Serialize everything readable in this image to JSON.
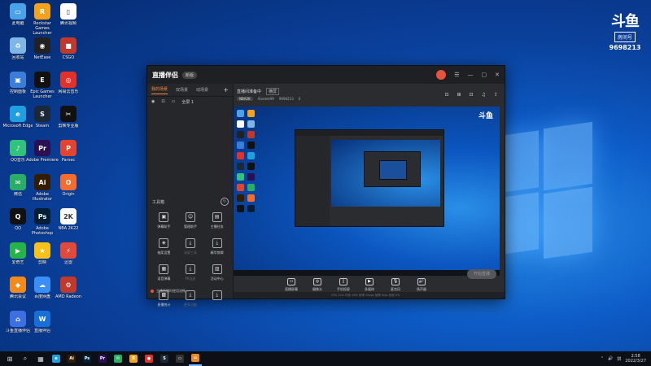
{
  "desktop": {
    "icons": [
      {
        "label": "此电脑",
        "color": "#4aa3e8",
        "glyph": "▭"
      },
      {
        "label": "Rockstar Games Launcher",
        "color": "#f3a21b",
        "glyph": "R"
      },
      {
        "label": "腾讯视频",
        "color": "#ffffff",
        "glyph": "▯"
      },
      {
        "label": "回收站",
        "color": "#7fb6e6",
        "glyph": "♻"
      },
      {
        "label": "NetEase",
        "color": "#222222",
        "glyph": "◉"
      },
      {
        "label": "CSGO",
        "color": "#c0392b",
        "glyph": "■"
      },
      {
        "label": "控制面板",
        "color": "#3b7dd8",
        "glyph": "▣"
      },
      {
        "label": "Epic Games Launcher",
        "color": "#111111",
        "glyph": "E"
      },
      {
        "label": "网易云音乐",
        "color": "#e0322b",
        "glyph": "◎"
      },
      {
        "label": "Microsoft Edge",
        "color": "#1f9ee0",
        "glyph": "e"
      },
      {
        "label": "Steam",
        "color": "#1b2838",
        "glyph": "S"
      },
      {
        "label": "剪映专业版",
        "color": "#111111",
        "glyph": "✂"
      },
      {
        "label": "QQ音乐",
        "color": "#31c27c",
        "glyph": "♪"
      },
      {
        "label": "Adobe Premiere",
        "color": "#2a0f55",
        "glyph": "Pr"
      },
      {
        "label": "Parsec",
        "color": "#e2452f",
        "glyph": "P"
      },
      {
        "label": "微信",
        "color": "#2aae67",
        "glyph": "✉"
      },
      {
        "label": "Adobe Illustrator",
        "color": "#331c00",
        "glyph": "Ai"
      },
      {
        "label": "Origin",
        "color": "#f56c2d",
        "glyph": "O"
      },
      {
        "label": "QQ",
        "color": "#111111",
        "glyph": "Q"
      },
      {
        "label": "Adobe Photoshop",
        "color": "#001e36",
        "glyph": "Ps"
      },
      {
        "label": "NBA 2K22",
        "color": "#ffffff",
        "glyph": "2K"
      },
      {
        "label": "爱奇艺",
        "color": "#25b34a",
        "glyph": "▶"
      },
      {
        "label": "剪映",
        "color": "#f6c21a",
        "glyph": "★"
      },
      {
        "label": "迅雷",
        "color": "#e04a3a",
        "glyph": "⚡"
      },
      {
        "label": "腾讯会议",
        "color": "#f08a1a",
        "glyph": "◆"
      },
      {
        "label": "百度网盘",
        "color": "#3a8ef6",
        "glyph": "☁"
      },
      {
        "label": "AMD Radeon",
        "color": "#c0392b",
        "glyph": "⚙"
      },
      {
        "label": "斗鱼直播伴侣",
        "color": "#3d6fe0",
        "glyph": "⌂"
      },
      {
        "label": "直播伴侣",
        "color": "#1a6fd6",
        "glyph": "W"
      }
    ]
  },
  "badge": {
    "logo": "斗鱼",
    "tag": "房间号",
    "room": "9698213"
  },
  "app": {
    "brand": "直播伴侣",
    "version": "新版",
    "titlebar_icons": [
      "☰",
      "—",
      "▢",
      "✕"
    ],
    "tabs": [
      {
        "label": "我的场景",
        "active": true
      },
      {
        "label": "双场景",
        "active": false
      },
      {
        "label": "动场景",
        "active": false
      }
    ],
    "scene_label": "全屏 1",
    "tools_title": "工具箱",
    "tools": [
      {
        "label": "弹幕助手",
        "glyph": "▣",
        "dim": false
      },
      {
        "label": "管理助手",
        "glyph": "☺",
        "dim": false
      },
      {
        "label": "主播任务",
        "glyph": "▤",
        "dim": false
      },
      {
        "label": "抽奖设置",
        "glyph": "◈",
        "dim": false
      },
      {
        "label": "录屏工具",
        "glyph": "⤓",
        "dim": true
      },
      {
        "label": "精华剪辑",
        "glyph": "⤓",
        "dim": false
      },
      {
        "label": "语音弹幕",
        "glyph": "▦",
        "dim": false
      },
      {
        "label": "PK连麦",
        "glyph": "⤓",
        "dim": true
      },
      {
        "label": "活动中心",
        "glyph": "▥",
        "dim": false
      },
      {
        "label": "直播统计",
        "glyph": "▩",
        "dim": false
      },
      {
        "label": "更多功能",
        "glyph": "⤓",
        "dim": true
      },
      {
        "label": "",
        "glyph": "⤓",
        "dim": true
      }
    ],
    "tips": "主播直播时使用流畅",
    "status": {
      "text": "直播间准备中",
      "tag": "横屏"
    },
    "meta": {
      "pill": "NBA2K",
      "user": "Alantek99",
      "room": "9698213",
      "fans": "0"
    },
    "head_icons": [
      "⊡",
      "⊞",
      "⊡",
      "♫",
      "⇪"
    ],
    "bottom_tools": [
      {
        "label": "直播屏幕",
        "glyph": "▭"
      },
      {
        "label": "摄像头",
        "glyph": "◎"
      },
      {
        "label": "手机投屏",
        "glyph": "▯"
      },
      {
        "label": "多媒体",
        "glyph": "▶"
      },
      {
        "label": "麦克风",
        "glyph": "🎙"
      },
      {
        "label": "扬声器",
        "glyph": "🔊"
      }
    ],
    "go_live": "开始直播",
    "stats": "CPU 12%   内存 38%   码率 0kbps   帧率 0fps   丢帧 0%"
  },
  "taskbar": {
    "apps": [
      {
        "glyph": "⊞",
        "color": "",
        "active": false
      },
      {
        "glyph": "⌕",
        "color": "",
        "active": false
      },
      {
        "glyph": "▦",
        "color": "",
        "active": false
      },
      {
        "glyph": "e",
        "color": "#1f9ee0",
        "active": false
      },
      {
        "glyph": "Ai",
        "color": "#331c00",
        "active": false
      },
      {
        "glyph": "Ps",
        "color": "#001e36",
        "active": false
      },
      {
        "glyph": "Pr",
        "color": "#2a0f55",
        "active": false
      },
      {
        "glyph": "✉",
        "color": "#2aae67",
        "active": false
      },
      {
        "glyph": "R",
        "color": "#f3a21b",
        "active": false
      },
      {
        "glyph": "●",
        "color": "#e0322b",
        "active": false
      },
      {
        "glyph": "S",
        "color": "#1b2838",
        "active": false
      },
      {
        "glyph": "▭",
        "color": "#333333",
        "active": false
      },
      {
        "glyph": "⌂",
        "color": "#e88a2a",
        "active": true
      }
    ],
    "tray_icons": [
      "⌃",
      "🔊",
      "拼"
    ],
    "time": "2:58",
    "date": "2022/3/27"
  }
}
